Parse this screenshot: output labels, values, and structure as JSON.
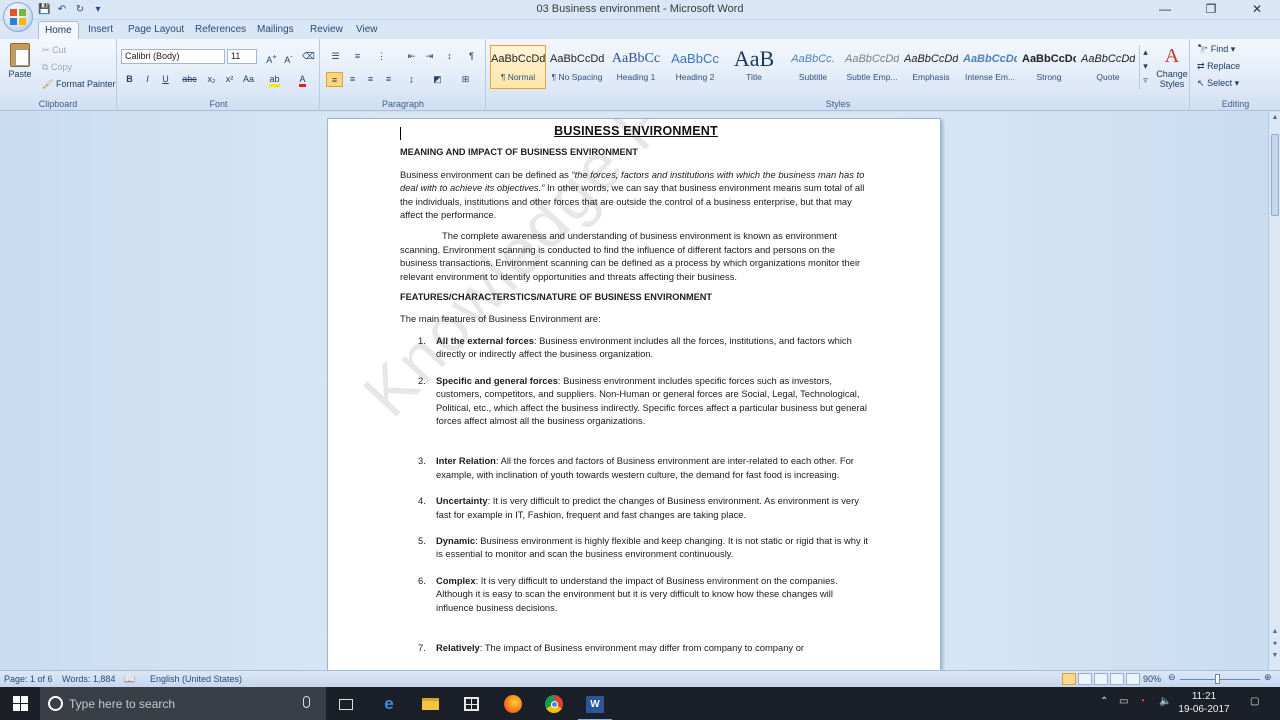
{
  "window": {
    "title": "03 Business environment - Microsoft Word",
    "controls": [
      "minimize",
      "restore",
      "close"
    ]
  },
  "ribbon_tabs": [
    "Home",
    "Insert",
    "Page Layout",
    "References",
    "Mailings",
    "Review",
    "View"
  ],
  "clipboard": {
    "paste": "Paste",
    "cut": "Cut",
    "copy": "Copy",
    "format_painter": "Format Painter",
    "label": "Clipboard"
  },
  "font": {
    "family": "Calibri (Body)",
    "size": "11",
    "label": "Font",
    "buttons": [
      "B",
      "I",
      "U",
      "abc",
      "x₂",
      "x²",
      "Aa"
    ]
  },
  "paragraph": {
    "label": "Paragraph"
  },
  "styles": {
    "label": "Styles",
    "items": [
      {
        "sample": "AaBbCcDd",
        "name": "¶ Normal"
      },
      {
        "sample": "AaBbCcDd",
        "name": "¶ No Spacing"
      },
      {
        "sample": "AaBbCc",
        "name": "Heading 1"
      },
      {
        "sample": "AaBbCc",
        "name": "Heading 2"
      },
      {
        "sample": "AaB",
        "name": "Title"
      },
      {
        "sample": "AaBbCc.",
        "name": "Subtitle"
      },
      {
        "sample": "AaBbCcDd",
        "name": "Subtle Emp..."
      },
      {
        "sample": "AaBbCcDd",
        "name": "Emphasis"
      },
      {
        "sample": "AaBbCcDd",
        "name": "Intense Em..."
      },
      {
        "sample": "AaBbCcDc",
        "name": "Strong"
      },
      {
        "sample": "AaBbCcDd",
        "name": "Quote"
      }
    ],
    "change_styles": "Change Styles"
  },
  "editing": {
    "label": "Editing",
    "find": "Find",
    "replace": "Replace",
    "select": "Select"
  },
  "document": {
    "title": "BUSINESS ENVIRONMENT",
    "h1": "MEANING AND IMPACT OF BUSINESS ENVIRONMENT",
    "p1_start": "Business environment can be defined as ",
    "p1_quote": "“the forces, factors and institutions with which the business man has to deal with to achieve its objectives.”",
    "p1_end": " In other words, we can say that business environment means sum total of all the individuals, institutions and other forces that are outside the control of a business enterprise, but that may affect the performance.",
    "p2": "The complete awareness and understanding of business environment is known as environment scanning. Environment scanning is conducted to find the influence of different factors and persons on the business transactions. Environment scanning can be defined as a process by which organizations monitor their relevant environment to identify opportunities and threats affecting their business.",
    "h2": "FEATURES/CHARACTERSTICS/NATURE OF BUSINESS ENVIRONMENT",
    "p3": "The main features of Business Environment are:",
    "features": [
      {
        "num": "1.",
        "term": "All the external forces",
        "text": ": Business environment includes all the forces, institutions, and factors which directly or indirectly affect the business organization."
      },
      {
        "num": "2.",
        "term": "Specific and general forces",
        "text": ": Business environment includes specific forces such as investors, customers, competitors, and suppliers. Non-Human or general forces are Social, Legal, Technological, Political, etc., which affect the business indirectly. Specific forces affect a particular business but general forces affect almost all the business organizations."
      },
      {
        "num": "3.",
        "term": "Inter Relation",
        "text": ": All the forces and factors of Business environment are inter-related to each other. For example, with inclination of youth towards western culture, the demand for fast food is increasing."
      },
      {
        "num": "4.",
        "term": "Uncertainty",
        "text": ": It is very difficult to predict the changes of Business environment. As environment is very fast for example in IT, Fashion, frequent and fast changes are taking place."
      },
      {
        "num": "5.",
        "term": "Dynamic",
        "text": ": Business environment is highly flexible and keep changing. It is not static or rigid that is why it is essential to monitor and scan the business environment continuously."
      },
      {
        "num": "6.",
        "term": "Complex",
        "text": ": It is very difficult to understand the impact of Business environment on the companies. Although it is easy to scan the environment but it is very difficult to know how these changes will influence business decisions."
      },
      {
        "num": "7.",
        "term": "Relatively",
        "text": ": The impact of Business environment may differ from company to company or"
      }
    ],
    "watermark": "Knowledge Point"
  },
  "status": {
    "page": "Page: 1 of 6",
    "words": "Words: 1,884",
    "language": "English (United States)",
    "zoom": "90%"
  },
  "taskbar": {
    "search_placeholder": "Type here to search",
    "time": "11:21",
    "date": "19-06-2017"
  }
}
